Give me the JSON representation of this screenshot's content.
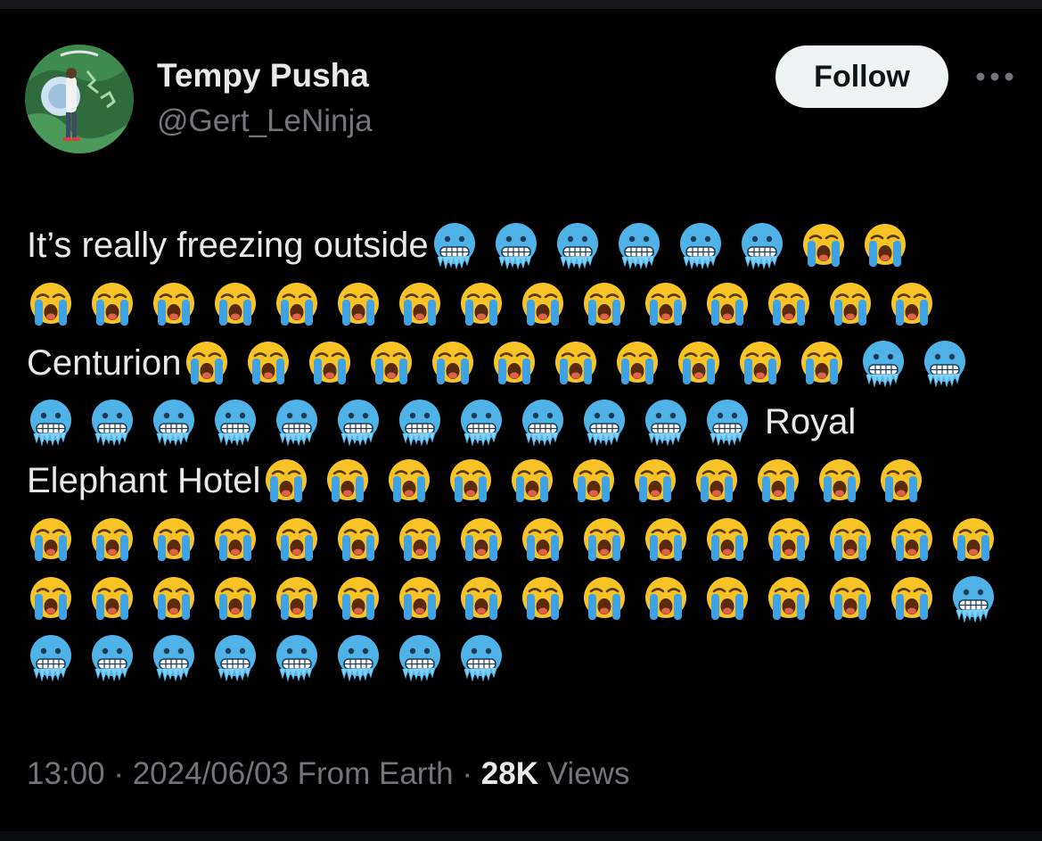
{
  "tweet": {
    "author": {
      "name": "Tempy Pusha",
      "handle": "@Gert_LeNinja"
    },
    "follow_label": "Follow",
    "more_icon": "more-horizontal-icon",
    "text_lines": [
      [
        {
          "t": "text",
          "v": "It’s really freezing outside"
        },
        {
          "t": "emoji",
          "v": "cold-face",
          "n": 6
        },
        {
          "t": "emoji",
          "v": "crying-face",
          "n": 2
        }
      ],
      [
        {
          "t": "emoji",
          "v": "crying-face",
          "n": 15
        }
      ],
      [
        {
          "t": "text",
          "v": "Centurion"
        },
        {
          "t": "emoji",
          "v": "crying-face",
          "n": 11
        },
        {
          "t": "emoji",
          "v": "cold-face",
          "n": 2
        }
      ],
      [
        {
          "t": "emoji",
          "v": "cold-face",
          "n": 12
        },
        {
          "t": "text",
          "v": "Royal"
        }
      ],
      [
        {
          "t": "text",
          "v": "Elephant Hotel"
        },
        {
          "t": "emoji",
          "v": "crying-face",
          "n": 11
        }
      ],
      [
        {
          "t": "emoji",
          "v": "crying-face",
          "n": 16
        }
      ],
      [
        {
          "t": "emoji",
          "v": "crying-face",
          "n": 15
        },
        {
          "t": "emoji",
          "v": "cold-face",
          "n": 1
        }
      ],
      [
        {
          "t": "emoji",
          "v": "cold-face",
          "n": 8
        }
      ]
    ],
    "meta": {
      "time": "13:00",
      "separator": " · ",
      "date": "2024/06/03",
      "source": "From Earth",
      "views_count": "28K",
      "views_label": "Views"
    }
  },
  "colors": {
    "background": "#000000",
    "text_primary": "#e7e9ea",
    "text_secondary": "#71767b",
    "follow_bg": "#eff3f4",
    "cold_face": "#4fb3e8",
    "crying_face": "#f7c325",
    "tears": "#3ea2e6"
  }
}
